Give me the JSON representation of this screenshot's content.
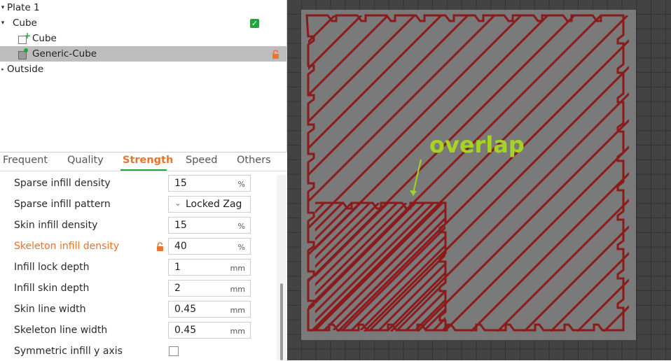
{
  "tree": {
    "plate": "Plate 1",
    "object": "Cube",
    "children": [
      "Cube",
      "Generic-Cube"
    ],
    "outside": "Outside"
  },
  "tabs": [
    "Frequent",
    "Quality",
    "Strength",
    "Speed",
    "Others"
  ],
  "active_tab": "Strength",
  "settings": [
    {
      "label": "Sparse infill density",
      "value": "15",
      "unit": "%"
    },
    {
      "label": "Sparse infill pattern",
      "value": "Locked Zag",
      "unit": ""
    },
    {
      "label": "Skin infill density",
      "value": "15",
      "unit": "%"
    },
    {
      "label": "Skeleton infill density",
      "value": "40",
      "unit": "%"
    },
    {
      "label": "Infill lock depth",
      "value": "1",
      "unit": "mm"
    },
    {
      "label": "Infill skin depth",
      "value": "2",
      "unit": "mm"
    },
    {
      "label": "Skin line width",
      "value": "0.45",
      "unit": "mm"
    },
    {
      "label": "Skeleton line width",
      "value": "0.45",
      "unit": "mm"
    },
    {
      "label": "Symmetric infill y axis",
      "value": "",
      "unit": ""
    }
  ],
  "viewport": {
    "annotation": "overlap"
  },
  "colors": {
    "accent": "#e8742f",
    "green": "#1ea83c",
    "toolpath": "#8b1a1a",
    "annotation": "#a6d41f"
  },
  "icons": [
    "collapse-arrow-icon",
    "checked-icon",
    "add-part-icon",
    "modifier-icon",
    "lock-icon",
    "dropdown-chevron-icon"
  ]
}
